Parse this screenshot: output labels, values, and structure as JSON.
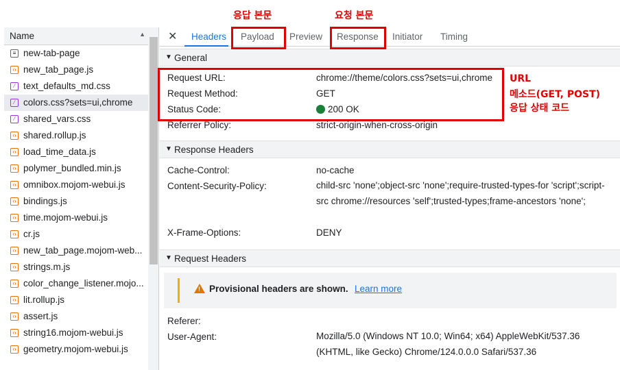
{
  "annotations": {
    "response_body": "응답 본문",
    "request_body": "요청 본문",
    "general_note_line1": "URL",
    "general_note_line2": "메소드(GET, POST)",
    "general_note_line3": "응답 상태 코드"
  },
  "file_list": {
    "header": "Name",
    "items": [
      {
        "name": "new-tab-page",
        "type": "doc"
      },
      {
        "name": "new_tab_page.js",
        "type": "js"
      },
      {
        "name": "text_defaults_md.css",
        "type": "css"
      },
      {
        "name": "colors.css?sets=ui,chrome",
        "type": "css",
        "selected": true
      },
      {
        "name": "shared_vars.css",
        "type": "css"
      },
      {
        "name": "shared.rollup.js",
        "type": "js"
      },
      {
        "name": "load_time_data.js",
        "type": "js"
      },
      {
        "name": "polymer_bundled.min.js",
        "type": "js"
      },
      {
        "name": "omnibox.mojom-webui.js",
        "type": "js"
      },
      {
        "name": "bindings.js",
        "type": "js"
      },
      {
        "name": "time.mojom-webui.js",
        "type": "js"
      },
      {
        "name": "cr.js",
        "type": "js"
      },
      {
        "name": "new_tab_page.mojom-web...",
        "type": "js"
      },
      {
        "name": "strings.m.js",
        "type": "js"
      },
      {
        "name": "color_change_listener.mojo...",
        "type": "js"
      },
      {
        "name": "lit.rollup.js",
        "type": "js"
      },
      {
        "name": "assert.js",
        "type": "js"
      },
      {
        "name": "string16.mojom-webui.js",
        "type": "js"
      },
      {
        "name": "geometry.mojom-webui.js",
        "type": "js"
      }
    ]
  },
  "tabs": {
    "close": "✕",
    "headers": "Headers",
    "payload": "Payload",
    "preview": "Preview",
    "response": "Response",
    "initiator": "Initiator",
    "timing": "Timing"
  },
  "general": {
    "title": "General",
    "request_url_key": "Request URL:",
    "request_url_val": "chrome://theme/colors.css?sets=ui,chrome",
    "request_method_key": "Request Method:",
    "request_method_val": "GET",
    "status_code_key": "Status Code:",
    "status_code_val": "200 OK",
    "referrer_policy_key": "Referrer Policy:",
    "referrer_policy_val": "strict-origin-when-cross-origin"
  },
  "response_headers": {
    "title": "Response Headers",
    "cache_control_key": "Cache-Control:",
    "cache_control_val": "no-cache",
    "csp_key": "Content-Security-Policy:",
    "csp_val": "child-src 'none';object-src 'none';require-trusted-types-for 'script';script-src chrome://resources 'self';trusted-types;frame-ancestors 'none';",
    "xfo_key": "X-Frame-Options:",
    "xfo_val": "DENY"
  },
  "request_headers": {
    "title": "Request Headers",
    "provisional_text": "Provisional headers are shown.",
    "learn_more": "Learn more",
    "referer_key": "Referer:",
    "user_agent_key": "User-Agent:",
    "user_agent_val": "Mozilla/5.0 (Windows NT 10.0; Win64; x64) AppleWebKit/537.36 (KHTML, like Gecko) Chrome/124.0.0.0 Safari/537.36"
  },
  "colors": {
    "annotation_red": "#e00000",
    "active_tab_blue": "#1a73e8",
    "status_green": "#188038",
    "warning_orange": "#e37400"
  }
}
